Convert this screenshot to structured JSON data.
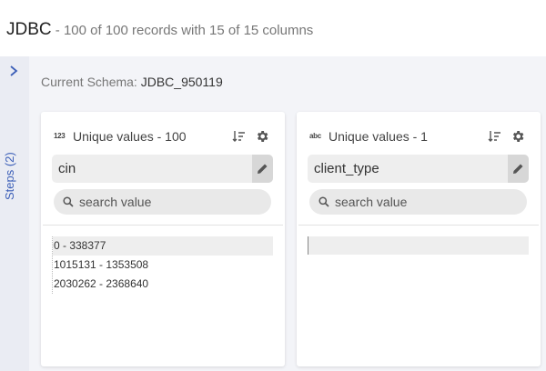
{
  "header": {
    "title": "JDBC",
    "subtitle": " - 100 of 100 records with 15 of 15 columns"
  },
  "steps": {
    "label": "Steps (2)",
    "icon": "chevron-right-icon"
  },
  "schema": {
    "label": "Current Schema: ",
    "value": "JDBC_950119"
  },
  "cards": [
    {
      "type_badge": "123",
      "unique_label": "Unique values - 100",
      "column_name": "cin",
      "search_placeholder": "search value",
      "values": [
        "0 - 338377",
        "1015131 - 1353508",
        "2030262 - 2368640"
      ]
    },
    {
      "type_badge": "abc",
      "unique_label": "Unique values - 1",
      "column_name": "client_type",
      "search_placeholder": "search value",
      "values": [
        ""
      ]
    }
  ],
  "colors": {
    "accent_blue": "#3c5fb8",
    "rail_bg": "#eaecf3",
    "main_bg": "#f3f4f8"
  }
}
